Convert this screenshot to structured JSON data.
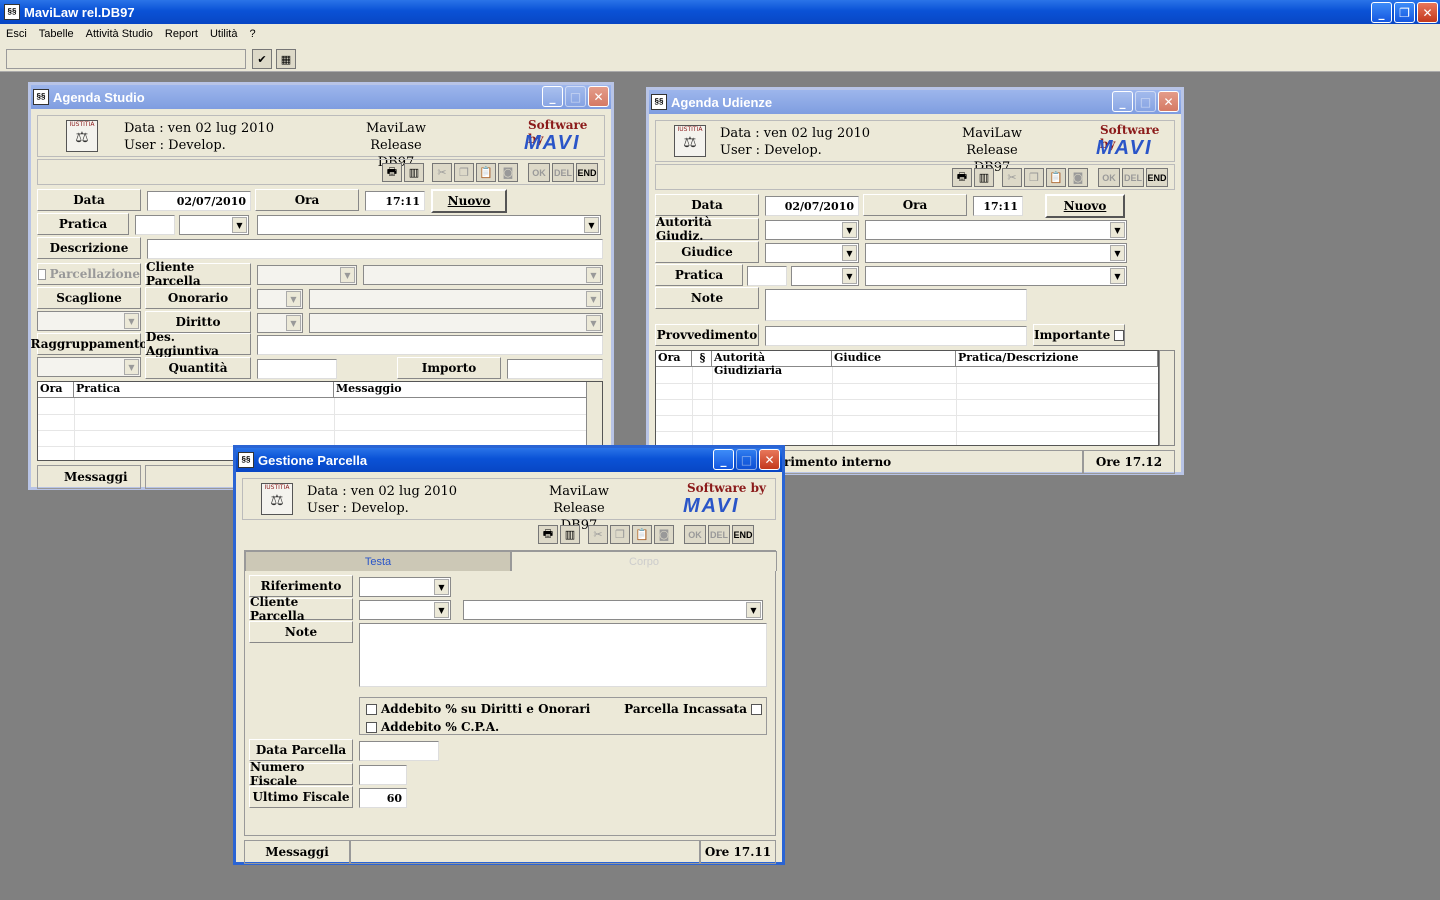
{
  "app": {
    "title": "MaviLaw rel.DB97",
    "icon": "app-icon"
  },
  "menu": [
    "Esci",
    "Tabelle",
    "Attività Studio",
    "Report",
    "Utilità",
    "?"
  ],
  "common": {
    "data_line": "Data : ven 02 lug 2010",
    "user_line": "User : Develop.",
    "product": "MaviLaw",
    "release": "Release DB97",
    "software_by": "Software by",
    "brand": "MAVI",
    "logo_text": "IUSTITIA",
    "btn_ok": "OK",
    "btn_del": "DEL",
    "btn_end": "END"
  },
  "agenda_studio": {
    "title": "Agenda Studio",
    "labels": {
      "data": "Data",
      "ora": "Ora",
      "pratica": "Pratica",
      "descrizione": "Descrizione",
      "parcellazione": "Parcellazione",
      "cliente_parcella": "Cliente Parcella",
      "scaglione": "Scaglione",
      "onorario": "Onorario",
      "diritto": "Diritto",
      "raggruppamento": "Raggruppamento",
      "des_aggiuntiva": "Des. Aggiuntiva",
      "quantita": "Quantità",
      "importo": "Importo"
    },
    "values": {
      "data": "02/07/2010",
      "ora": "17:11"
    },
    "nuovo": "Nuovo",
    "grid_cols": [
      "Ora",
      "Pratica",
      "Messaggio"
    ],
    "status": "Messaggi"
  },
  "agenda_udienze": {
    "title": "Agenda Udienze",
    "labels": {
      "data": "Data",
      "ora": "Ora",
      "autorita": "Autorità Giudiz.",
      "giudice": "Giudice",
      "pratica": "Pratica",
      "note": "Note",
      "provvedimento": "Provvedimento",
      "importante": "Importante"
    },
    "values": {
      "data": "02/07/2010",
      "ora": "17:11"
    },
    "nuovo": "Nuovo",
    "grid_cols": [
      "Ora",
      "§",
      "Autorità Giudiziaria",
      "Giudice",
      "Pratica/Descrizione"
    ],
    "status_text": "rimento interno",
    "status_time": "Ore 17.12"
  },
  "gestione_parcella": {
    "title": "Gestione Parcella",
    "tabs": [
      "Testa",
      "Corpo"
    ],
    "labels": {
      "riferimento": "Riferimento",
      "cliente_parcella": "Cliente Parcella",
      "note": "Note",
      "addebito_diritti": "Addebito % su Diritti e Onorari",
      "addebito_cpa": "Addebito % C.P.A.",
      "parcella_incassata": "Parcella Incassata",
      "data_parcella": "Data Parcella",
      "numero_fiscale": "Numero Fiscale",
      "ultimo_fiscale": "Ultimo Fiscale"
    },
    "values": {
      "ultimo_fiscale": "60"
    },
    "status": "Messaggi",
    "status_time": "Ore 17.11"
  },
  "colors": {
    "titlebar": "#0a52d6",
    "face": "#ece9d8",
    "desktop": "#808080",
    "brand": "#2a55c8",
    "accent_red": "#8b1a1a"
  }
}
